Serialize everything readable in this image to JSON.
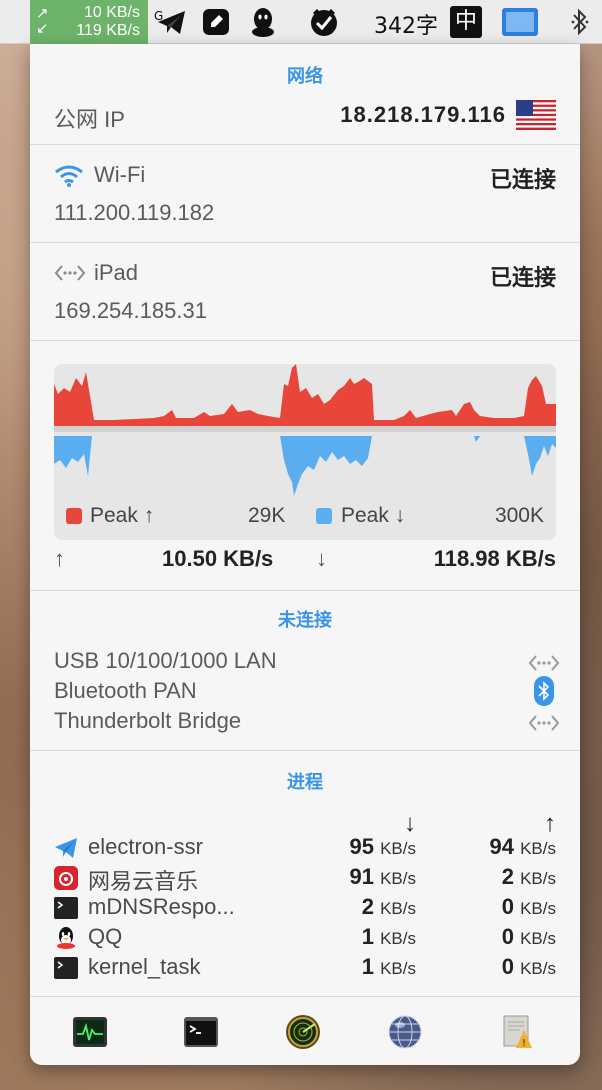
{
  "menubar": {
    "net_up": "10 KB/s",
    "net_down": "119 KB/s",
    "net_arrows": "↗↙",
    "char_count": "342字",
    "input_method": "中",
    "icons": [
      "telegram-icon",
      "notes-icon",
      "qq-icon",
      "clash-icon",
      "screen-icon",
      "bluetooth-icon"
    ]
  },
  "network": {
    "title": "网络",
    "public_ip_label": "公网 IP",
    "public_ip": "18.218.179.116",
    "flag": "us-flag"
  },
  "wifi": {
    "name": "Wi-Fi",
    "status": "已连接",
    "ip": "111.200.119.182"
  },
  "ipad": {
    "name": "iPad",
    "status": "已连接",
    "ip": "169.254.185.31"
  },
  "graph": {
    "upload_color": "#e8463a",
    "download_color": "#5aaef0",
    "peak_up_label": "Peak ↑",
    "peak_up_value": "29K",
    "peak_down_label": "Peak ↓",
    "peak_down_value": "300K"
  },
  "rates": {
    "up_arrow": "↑",
    "up_value": "10.50 KB/s",
    "down_arrow": "↓",
    "down_value": "118.98 KB/s"
  },
  "disconnected": {
    "title": "未连接",
    "items": [
      {
        "name": "USB 10/100/1000 LAN",
        "icon": "ethernet-icon"
      },
      {
        "name": "Bluetooth PAN",
        "icon": "bluetooth-icon"
      },
      {
        "name": "Thunderbolt Bridge",
        "icon": "ethernet-icon"
      }
    ]
  },
  "processes": {
    "title": "进程",
    "down_header": "↓",
    "up_header": "↑",
    "unit": "KB/s",
    "rows": [
      {
        "name": "electron-ssr",
        "down": "95",
        "up": "94",
        "icon": "telegram-icon"
      },
      {
        "name": "网易云音乐",
        "down": "91",
        "up": "2",
        "icon": "netease-music-icon"
      },
      {
        "name": "mDNSRespo...",
        "down": "2",
        "up": "0",
        "icon": "terminal-icon"
      },
      {
        "name": "QQ",
        "down": "1",
        "up": "0",
        "icon": "qq-icon"
      },
      {
        "name": "kernel_task",
        "down": "1",
        "up": "0",
        "icon": "terminal-icon"
      }
    ]
  },
  "toolbar": [
    "activity-monitor-icon",
    "terminal-icon",
    "radar-icon",
    "network-utility-icon",
    "console-icon"
  ]
}
